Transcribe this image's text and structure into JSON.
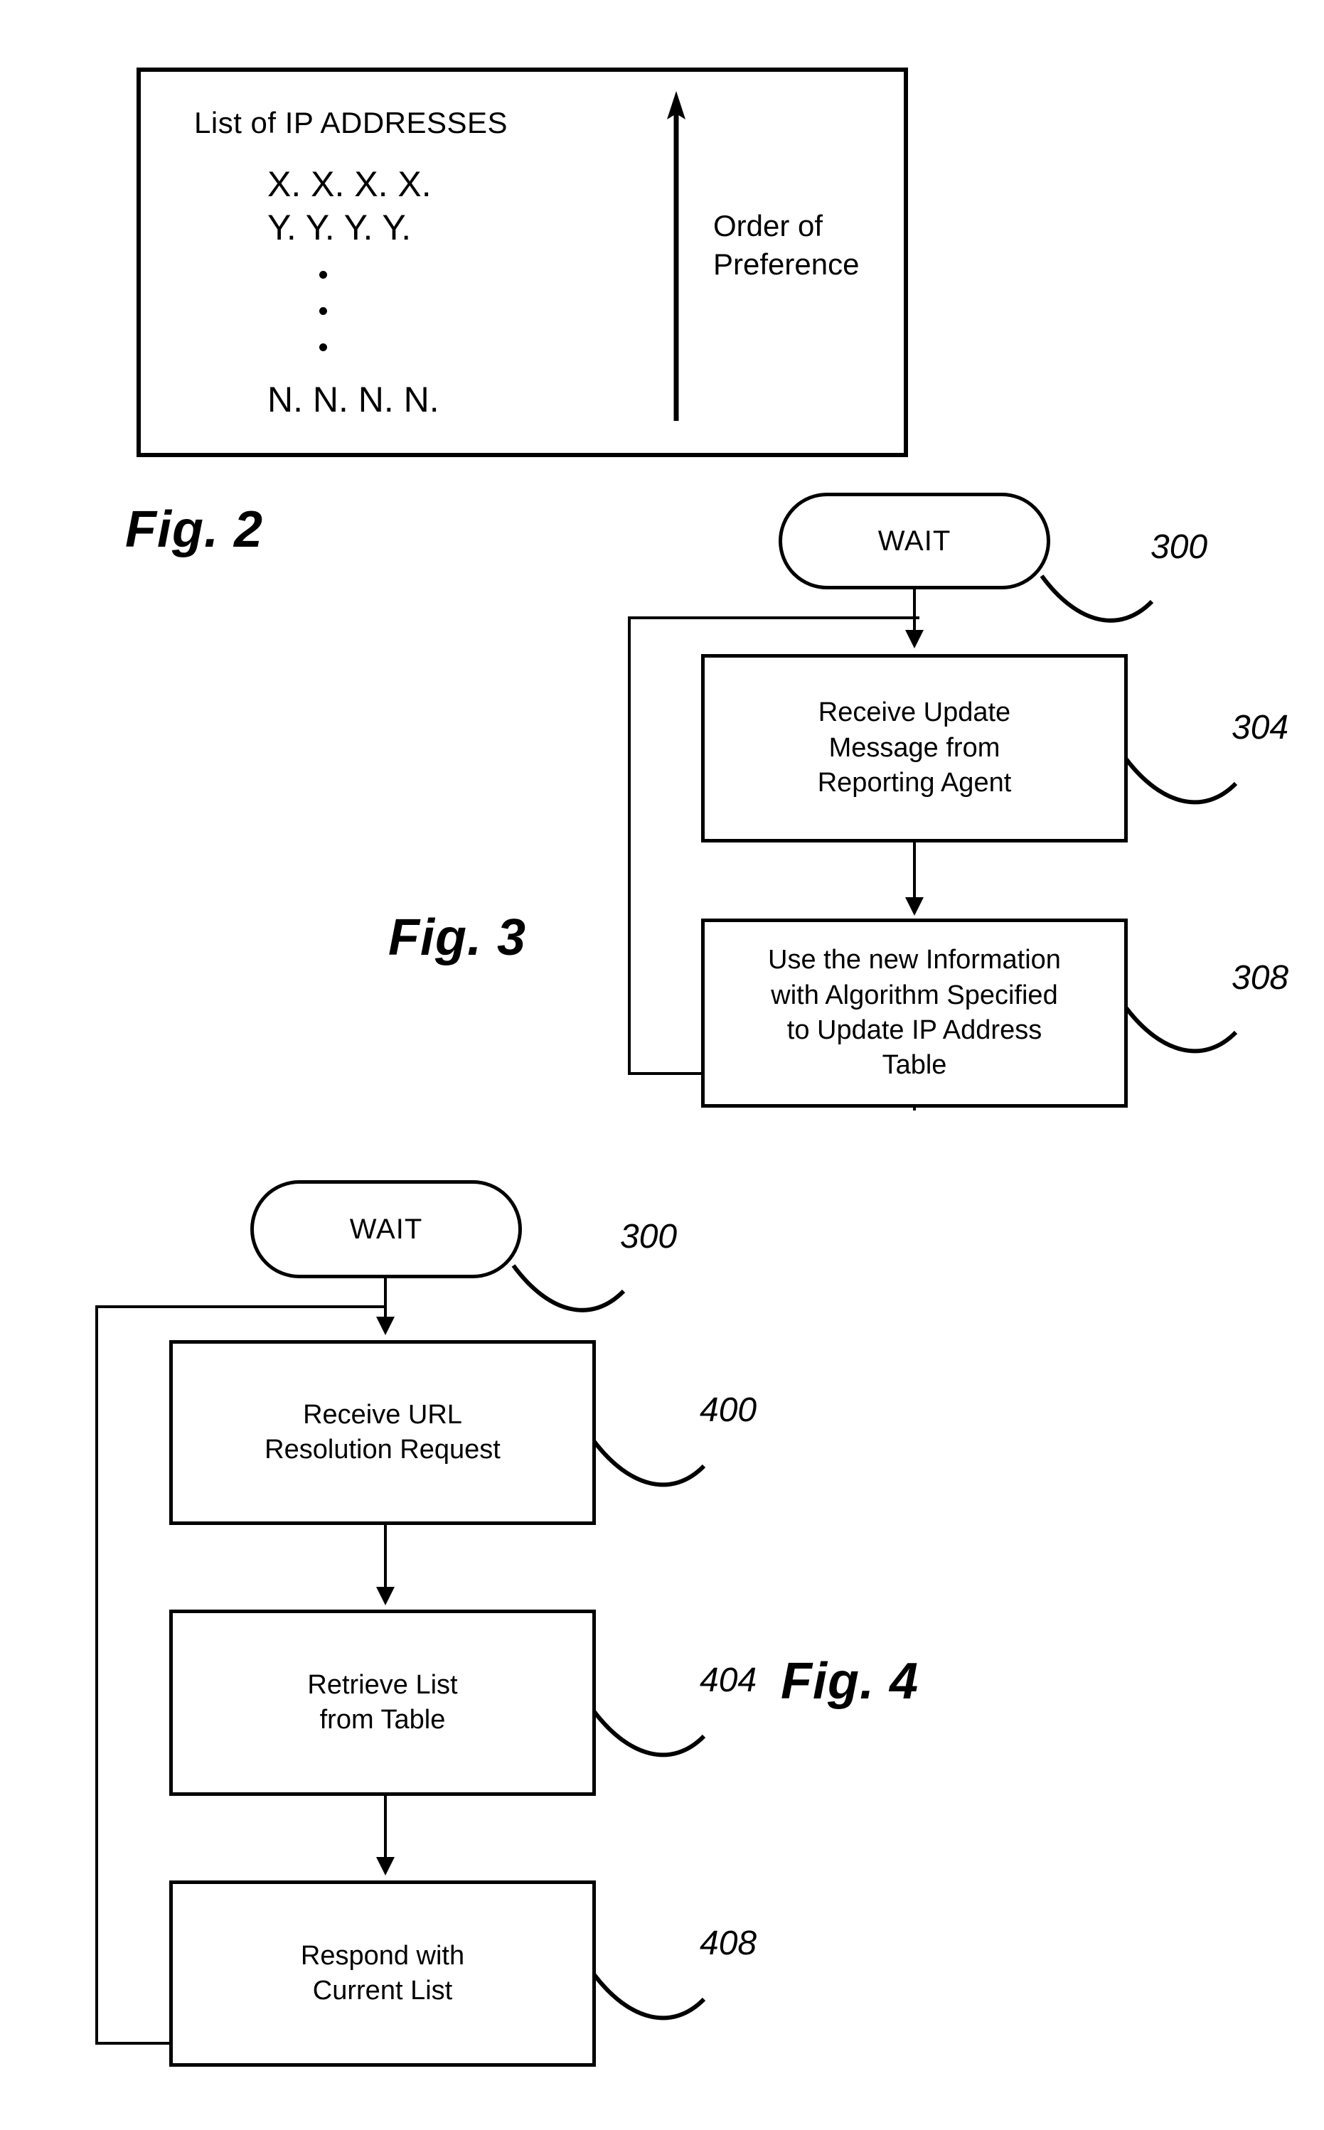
{
  "figures": {
    "fig2": {
      "caption": "Fig. 2",
      "box_title": "List of IP ADDRESSES",
      "entries": [
        "X. X. X. X.",
        "Y. Y. Y. Y."
      ],
      "ellipsis_dots": 3,
      "last_entry": "N. N. N. N.",
      "arrow_label_line1": "Order of",
      "arrow_label_line2": "Preference",
      "arrow_direction": "up"
    },
    "fig3": {
      "caption": "Fig. 3",
      "start_node": {
        "label": "WAIT",
        "ref": "300"
      },
      "steps": [
        {
          "ref": "304",
          "lines": [
            "Receive Update",
            "Message from",
            "Reporting Agent"
          ]
        },
        {
          "ref": "308",
          "lines": [
            "Use the new Information",
            "with Algorithm Specified",
            "to Update IP Address",
            "Table"
          ]
        }
      ]
    },
    "fig4": {
      "caption": "Fig. 4",
      "start_node": {
        "label": "WAIT",
        "ref": "300"
      },
      "steps": [
        {
          "ref": "400",
          "lines": [
            "Receive URL",
            "Resolution Request"
          ]
        },
        {
          "ref": "404",
          "lines": [
            "Retrieve List",
            "from Table"
          ]
        },
        {
          "ref": "408",
          "lines": [
            "Respond with",
            "Current List"
          ]
        }
      ]
    }
  },
  "colors": {
    "ink": "#000000",
    "paper": "#ffffff"
  }
}
